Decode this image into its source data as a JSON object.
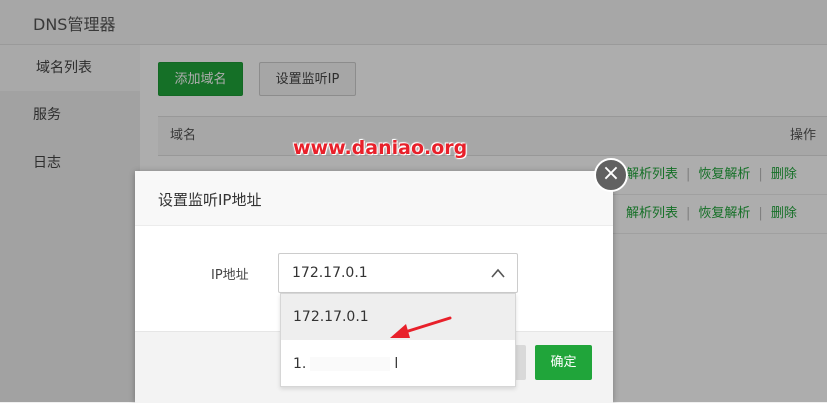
{
  "app": {
    "title": "DNS管理器"
  },
  "sidebar": {
    "items": [
      {
        "label": "域名列表"
      },
      {
        "label": "服务"
      },
      {
        "label": "日志"
      }
    ]
  },
  "toolbar": {
    "add_domain": "添加域名",
    "set_listen_ip": "设置监听IP"
  },
  "table": {
    "headers": {
      "domain": "域名",
      "actions": "操作"
    },
    "rows": [
      {
        "ops": [
          "解析列表",
          "恢复解析",
          "删除"
        ]
      },
      {
        "ops": [
          "解析列表",
          "恢复解析",
          "删除"
        ]
      }
    ]
  },
  "watermark": "www.daniao.org",
  "dialog": {
    "title": "设置监听IP地址",
    "field_label": "IP地址",
    "selected_value": "172.17.0.1",
    "options": [
      {
        "label": "172.17.0.1"
      },
      {
        "label_prefix": "1.",
        "label_suffix": "l"
      }
    ],
    "confirm_label": "确定"
  },
  "icons": {
    "close": "close-icon",
    "chevron": "chevron-up-icon",
    "annotation": "red-arrow"
  },
  "colors": {
    "accent": "#20a53a",
    "watermark": "#e8202a"
  }
}
